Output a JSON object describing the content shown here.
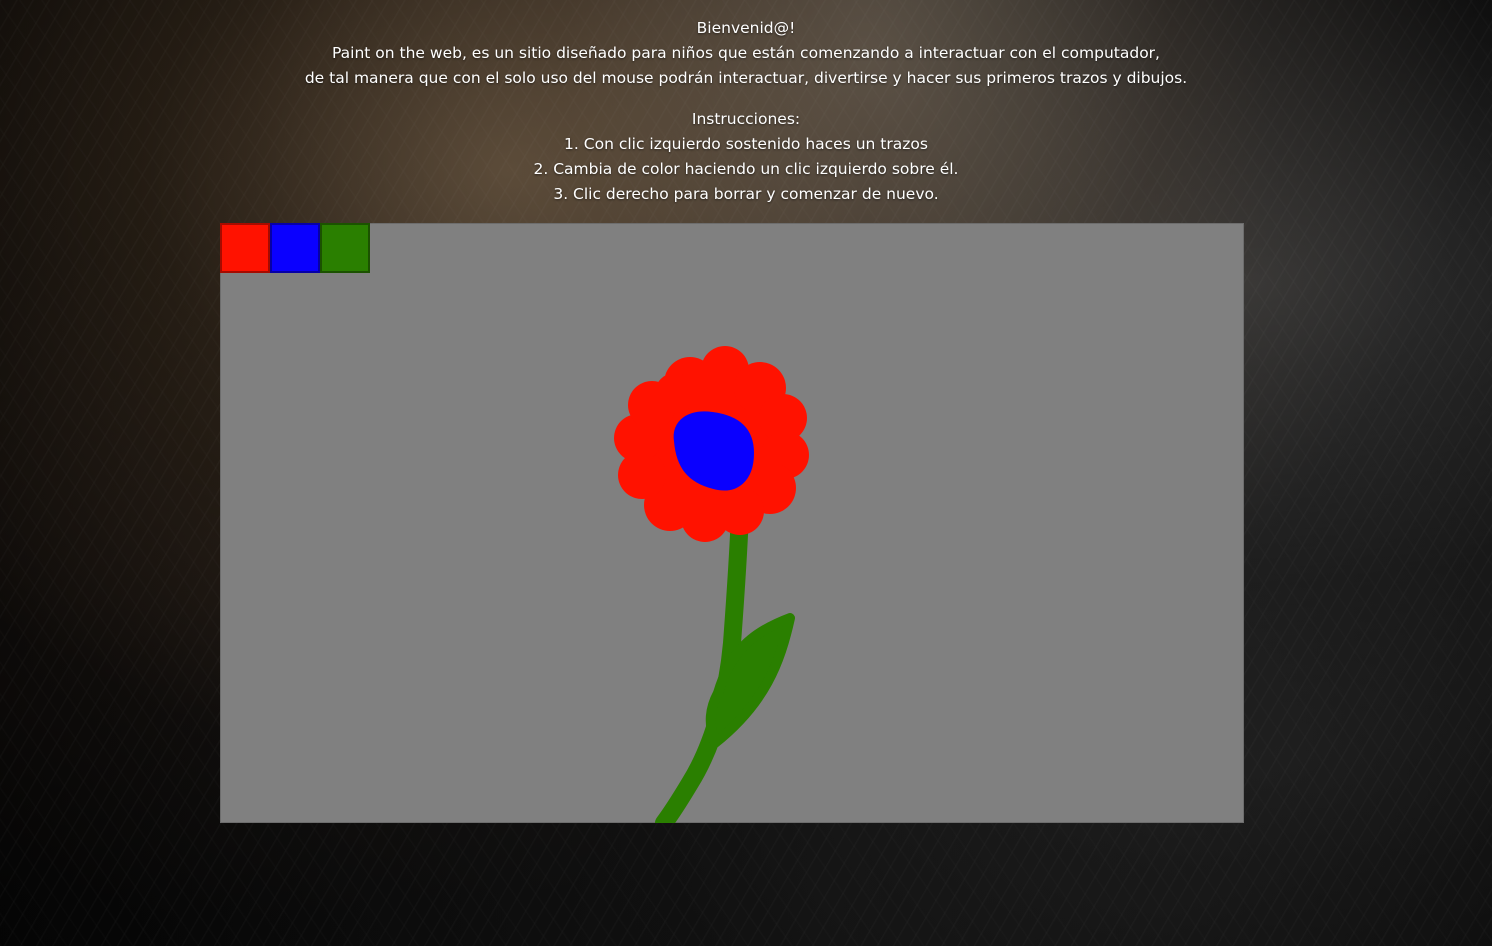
{
  "intro": {
    "greeting": "Bienvenid@!",
    "description_lines": [
      "Paint on the web, es un sitio diseñado para niños que están comenzando a interactuar con el computador,",
      "de tal manera que con el solo uso del mouse podrán interactuar, divertirse y hacer sus primeros trazos y dibujos."
    ],
    "instructions_title": "Instrucciones:",
    "instructions": [
      "1. Con clic izquierdo sostenido haces un trazos",
      "2. Cambia de color haciendo un clic izquierdo sobre él.",
      "3. Clic derecho para borrar y comenzar de nuevo."
    ]
  },
  "palette": {
    "colors": [
      {
        "name": "red",
        "hex": "#ff1200"
      },
      {
        "name": "blue",
        "hex": "#0a00ff"
      },
      {
        "name": "green",
        "hex": "#2a7f00"
      }
    ]
  },
  "canvas": {
    "background_hex": "#808080"
  }
}
